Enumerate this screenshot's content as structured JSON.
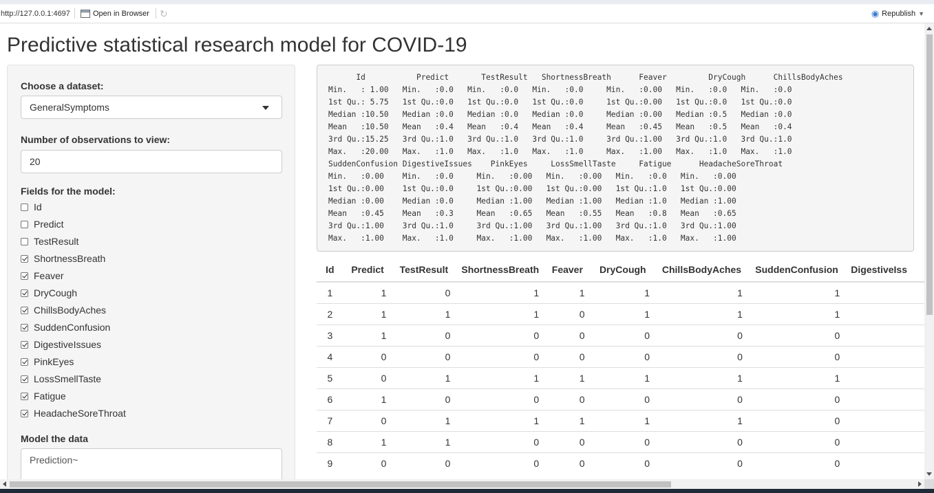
{
  "toolbar": {
    "url": "http://127.0.0.1:4697",
    "open_in_browser": "Open in Browser",
    "republish": "Republish"
  },
  "app": {
    "title": "Predictive statistical research model for COVID-19"
  },
  "sidebar": {
    "dataset_label": "Choose a dataset:",
    "dataset_value": "GeneralSymptoms",
    "obs_label": "Number of observations to view:",
    "obs_value": "20",
    "fields_label": "Fields for the model:",
    "fields": [
      {
        "label": "Id",
        "checked": false
      },
      {
        "label": "Predict",
        "checked": false
      },
      {
        "label": "TestResult",
        "checked": false
      },
      {
        "label": "ShortnessBreath",
        "checked": true
      },
      {
        "label": "Feaver",
        "checked": true
      },
      {
        "label": "DryCough",
        "checked": true
      },
      {
        "label": "ChillsBodyAches",
        "checked": true
      },
      {
        "label": "SuddenConfusion",
        "checked": true
      },
      {
        "label": "DigestiveIssues",
        "checked": true
      },
      {
        "label": "PinkEyes",
        "checked": true
      },
      {
        "label": "LossSmellTaste",
        "checked": true
      },
      {
        "label": "Fatigue",
        "checked": true
      },
      {
        "label": "HeadacheSoreThroat",
        "checked": true
      }
    ],
    "model_label": "Model the data",
    "model_value": "Prediction~"
  },
  "summary": {
    "text": "      Id           Predict       TestResult   ShortnessBreath      Feaver         DryCough      ChillsBodyAches\nMin.   : 1.00   Min.   :0.0   Min.   :0.0   Min.   :0.0     Min.   :0.00   Min.   :0.0   Min.   :0.0  \n1st Qu.: 5.75   1st Qu.:0.0   1st Qu.:0.0   1st Qu.:0.0     1st Qu.:0.00   1st Qu.:0.0   1st Qu.:0.0  \nMedian :10.50   Median :0.0   Median :0.0   Median :0.0     Median :0.00   Median :0.5   Median :0.0  \nMean   :10.50   Mean   :0.4   Mean   :0.4   Mean   :0.4     Mean   :0.45   Mean   :0.5   Mean   :0.4  \n3rd Qu.:15.25   3rd Qu.:1.0   3rd Qu.:1.0   3rd Qu.:1.0     3rd Qu.:1.00   3rd Qu.:1.0   3rd Qu.:1.0  \nMax.   :20.00   Max.   :1.0   Max.   :1.0   Max.   :1.0     Max.   :1.00   Max.   :1.0   Max.   :1.0  \nSuddenConfusion DigestiveIssues    PinkEyes     LossSmellTaste     Fatigue      HeadacheSoreThroat\nMin.   :0.00    Min.   :0.0     Min.   :0.00   Min.   :0.00   Min.   :0.0   Min.   :0.00      \n1st Qu.:0.00    1st Qu.:0.0     1st Qu.:0.00   1st Qu.:0.00   1st Qu.:1.0   1st Qu.:0.00      \nMedian :0.00    Median :0.0     Median :1.00   Median :1.00   Median :1.0   Median :1.00      \nMean   :0.45    Mean   :0.3     Mean   :0.65   Mean   :0.55   Mean   :0.8   Mean   :0.65      \n3rd Qu.:1.00    3rd Qu.:1.0     3rd Qu.:1.00   3rd Qu.:1.00   3rd Qu.:1.0   3rd Qu.:1.00      \nMax.   :1.00    Max.   :1.0     Max.   :1.00   Max.   :1.00   Max.   :1.0   Max.   :1.00      "
  },
  "table": {
    "headers": [
      "Id",
      "Predict",
      "TestResult",
      "ShortnessBreath",
      "Feaver",
      "DryCough",
      "ChillsBodyAches",
      "SuddenConfusion",
      "DigestiveIss"
    ],
    "rows": [
      [
        "1",
        "1",
        "0",
        "1",
        "1",
        "1",
        "1",
        "1",
        ""
      ],
      [
        "2",
        "1",
        "1",
        "1",
        "0",
        "1",
        "1",
        "1",
        ""
      ],
      [
        "3",
        "1",
        "0",
        "0",
        "0",
        "0",
        "0",
        "0",
        ""
      ],
      [
        "4",
        "0",
        "0",
        "0",
        "0",
        "0",
        "0",
        "0",
        ""
      ],
      [
        "5",
        "0",
        "1",
        "1",
        "1",
        "1",
        "1",
        "1",
        ""
      ],
      [
        "6",
        "1",
        "0",
        "0",
        "0",
        "0",
        "0",
        "0",
        ""
      ],
      [
        "7",
        "0",
        "1",
        "1",
        "1",
        "1",
        "1",
        "0",
        ""
      ],
      [
        "8",
        "1",
        "1",
        "0",
        "0",
        "0",
        "0",
        "0",
        ""
      ],
      [
        "9",
        "0",
        "0",
        "0",
        "0",
        "0",
        "0",
        "0",
        ""
      ]
    ]
  }
}
